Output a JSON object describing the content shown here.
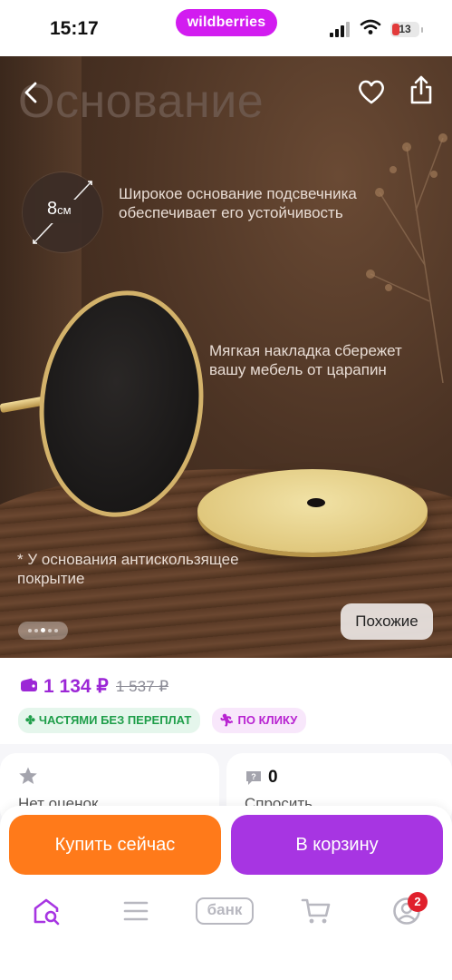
{
  "status_bar": {
    "time": "15:17",
    "brand": "wildberries",
    "battery": "13"
  },
  "hero": {
    "title": "Основание",
    "size_value": "8",
    "size_unit": "см",
    "note_base": "Широкое основание подсвечника обеспечивает его устойчивость",
    "note_pad": "Мягкая накладка сбережет вашу мебель от царапин",
    "note_antislip": "* У основания антискользящее покрытие",
    "similar_button": "Похожие",
    "slide_count": 5,
    "active_slide": 3
  },
  "price": {
    "current": "1 134 ₽",
    "old": "1 537 ₽"
  },
  "chips": {
    "installments": "ЧАСТЯМИ БЕЗ ПЕРЕПЛАТ",
    "one_click": "ПО КЛИКУ"
  },
  "rating": {
    "label": "Нет оценок"
  },
  "questions": {
    "count": "0",
    "label": "Спросить"
  },
  "actions": {
    "buy_now": "Купить сейчас",
    "add_to_cart": "В корзину"
  },
  "nav": {
    "cart_badge": "2",
    "bank_label": "банк"
  },
  "colors": {
    "brand": "#d21cf0",
    "buy": "#ff7a1a",
    "cart": "#a735e2",
    "price": "#9c27d6",
    "badge": "#e0202c"
  },
  "icons": [
    "back-icon",
    "heart-icon",
    "share-icon",
    "wallet-icon",
    "clover-icon",
    "runner-icon",
    "star-icon",
    "question-icon",
    "home-search-icon",
    "menu-icon",
    "bank-icon",
    "cart-icon",
    "profile-icon"
  ]
}
